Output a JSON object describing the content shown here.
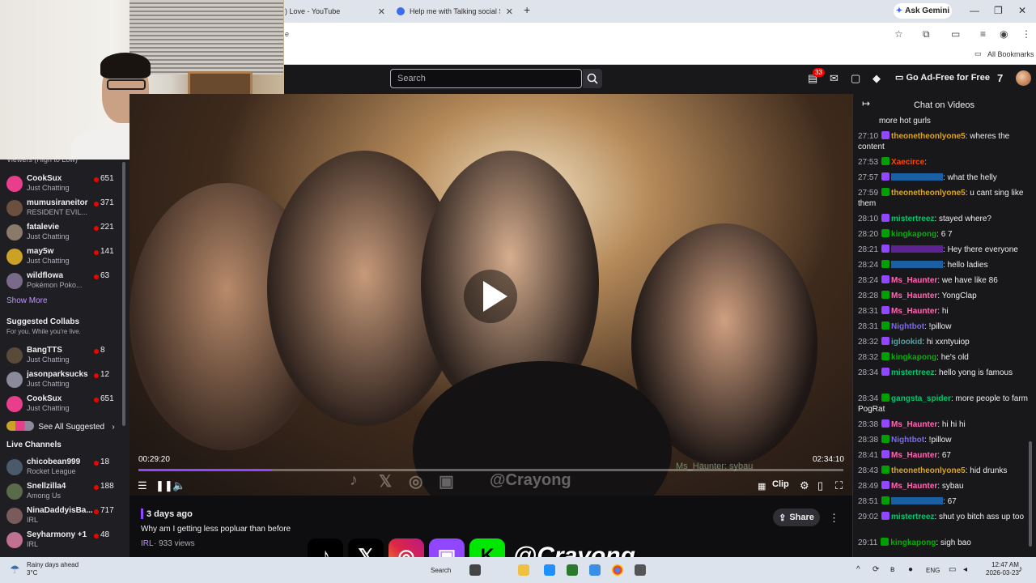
{
  "browser": {
    "tabs": [
      {
        "title": ") Love - YouTube"
      },
      {
        "title": "Help me with Talking social Skills"
      }
    ],
    "new_tab_label": "+",
    "ask_gemini": "Ask Gemini",
    "address_fragment": "e",
    "bookmarks_label": "All Bookmarks",
    "window_controls": {
      "minimize": "—",
      "restore": "❐",
      "close": "✕"
    }
  },
  "twitch_header": {
    "search_placeholder": "Search",
    "notifications_count": "33",
    "ad_free_label": "Go Ad-Free for Free"
  },
  "sidebar": {
    "viewers_heading": "Viewers (High to Low)",
    "followed": [
      {
        "name": "CookSux",
        "category": "Just Chatting",
        "viewers": "651",
        "color": "#e83e8c"
      },
      {
        "name": "mumusiraneitor",
        "category": "RESIDENT EVIL...",
        "viewers": "371",
        "color": "#6b4f3f"
      },
      {
        "name": "fatalevie",
        "category": "Just Chatting",
        "viewers": "221",
        "color": "#8a7a6a"
      },
      {
        "name": "may5w",
        "category": "Just Chatting",
        "viewers": "141",
        "color": "#c9a227"
      },
      {
        "name": "wildflowa",
        "category": "Pokémon Poko...",
        "viewers": "63",
        "color": "#7a6a8a"
      }
    ],
    "show_more": "Show More",
    "suggested_heading": "Suggested Collabs",
    "suggested_sub": "For you. While you're live.",
    "suggested": [
      {
        "name": "BangTTS",
        "category": "Just Chatting",
        "viewers": "8",
        "color": "#5a4a3a"
      },
      {
        "name": "jasonparksucks",
        "category": "Just Chatting",
        "viewers": "12",
        "color": "#8a8a9a"
      },
      {
        "name": "CookSux",
        "category": "Just Chatting",
        "viewers": "651",
        "color": "#e83e8c"
      }
    ],
    "see_all_suggested": "See All Suggested",
    "live_heading": "Live Channels",
    "live": [
      {
        "name": "chicobean999",
        "category": "Rocket League",
        "viewers": "18",
        "color": "#4a5a6a"
      },
      {
        "name": "Snellzilla4",
        "category": "Among Us",
        "viewers": "188",
        "color": "#5a6a4a"
      },
      {
        "name": "NinaDaddyisBa...",
        "category": "IRL",
        "viewers": "717",
        "color": "#7a5a5a"
      },
      {
        "name": "Seyharmony +1",
        "category": "IRL",
        "viewers": "48",
        "color": "#c07090"
      }
    ]
  },
  "video": {
    "current_time": "00:29:20",
    "total_time": "02:34:10",
    "progress": 0.19,
    "clip_label": "Clip",
    "overlay_handle": "@Crayong",
    "overlay_chat": "Ms_Haunter: sybau"
  },
  "video_info": {
    "date": "3 days ago",
    "title": "Why am I getting less popluar than before",
    "category": "IRL",
    "views": " · 933 views",
    "share_label": "Share"
  },
  "chat": {
    "title": "Chat on Videos",
    "messages": [
      {
        "ts": "",
        "user": "",
        "text": "more hot gurls",
        "color": "#efeff1"
      },
      {
        "ts": "27:10",
        "user": "theonetheonlyone5",
        "text": ": wheres the content",
        "color": "#daa520"
      },
      {
        "ts": "27:53",
        "user": "Xaecirce",
        "text": ":",
        "color": "#ff4500"
      },
      {
        "ts": "27:57",
        "user": "",
        "text": ": what the helly",
        "color": "#1e90ff"
      },
      {
        "ts": "27:59",
        "user": "theonetheonlyone5",
        "text": ": u cant sing like them",
        "color": "#daa520"
      },
      {
        "ts": "28:10",
        "user": "mistertreez",
        "text": ": stayed where?",
        "color": "#00c86e"
      },
      {
        "ts": "28:20",
        "user": "kingkapong",
        "text": ": 6 7",
        "color": "#00b000"
      },
      {
        "ts": "28:21",
        "user": "",
        "text": ": Hey there everyone",
        "color": "#8a2be2"
      },
      {
        "ts": "28:24",
        "user": "",
        "text": ": hello ladies",
        "color": "#1e90ff"
      },
      {
        "ts": "28:24",
        "user": "Ms_Haunter",
        "text": ": we have like 86",
        "color": "#ff69b4"
      },
      {
        "ts": "28:28",
        "user": "Ms_Haunter",
        "text": ": YongClap",
        "color": "#ff69b4"
      },
      {
        "ts": "28:31",
        "user": "Ms_Haunter",
        "text": ": hi",
        "color": "#ff69b4"
      },
      {
        "ts": "28:31",
        "user": "Nightbot",
        "text": ": !pillow",
        "color": "#7b68ee"
      },
      {
        "ts": "28:32",
        "user": "iglookid",
        "text": ": hi xxntyuiop",
        "color": "#5f9ea0"
      },
      {
        "ts": "28:32",
        "user": "kingkapong",
        "text": ": he's old",
        "color": "#00b000"
      },
      {
        "ts": "28:34",
        "user": "mistertreez",
        "text": ": hello yong is famous",
        "color": "#00c86e"
      },
      {
        "ts": "28:34",
        "user": "gangsta_spider",
        "text": ": more people to farm PogRat",
        "color": "#00c86e"
      },
      {
        "ts": "28:38",
        "user": "Ms_Haunter",
        "text": ": hi hi hi",
        "color": "#ff69b4"
      },
      {
        "ts": "28:38",
        "user": "Nightbot",
        "text": ": !pillow",
        "color": "#7b68ee"
      },
      {
        "ts": "28:41",
        "user": "Ms_Haunter",
        "text": ": 67",
        "color": "#ff69b4"
      },
      {
        "ts": "28:43",
        "user": "theonetheonlyone5",
        "text": ": hid drunks",
        "color": "#daa520"
      },
      {
        "ts": "28:49",
        "user": "Ms_Haunter",
        "text": ": sybau",
        "color": "#ff69b4"
      },
      {
        "ts": "28:51",
        "user": "",
        "text": ": 67",
        "color": "#1e90ff"
      },
      {
        "ts": "29:02",
        "user": "mistertreez",
        "text": ": shut yo bitch ass up too",
        "color": "#00c86e"
      },
      {
        "ts": "29:11",
        "user": "kingkapong",
        "text": ": sigh bao",
        "color": "#00b000"
      }
    ]
  },
  "overlay": {
    "handle": "@Crayong",
    "icons": [
      {
        "name": "tiktok-icon",
        "glyph": "♪",
        "color": "#000000"
      },
      {
        "name": "x-icon",
        "glyph": "𝕏",
        "color": "#000000"
      },
      {
        "name": "instagram-icon",
        "glyph": "◎",
        "color": "#d6249f"
      },
      {
        "name": "twitch-icon",
        "glyph": "▣",
        "color": "#9146ff"
      },
      {
        "name": "kick-icon",
        "glyph": "K",
        "color": "#00e701"
      }
    ]
  },
  "taskbar": {
    "weather_title": "Rainy days ahead",
    "weather_temp": "3°C",
    "search_label": "Search",
    "language": "ENG",
    "time": "12:47 AM",
    "date": "2026-03-23"
  }
}
